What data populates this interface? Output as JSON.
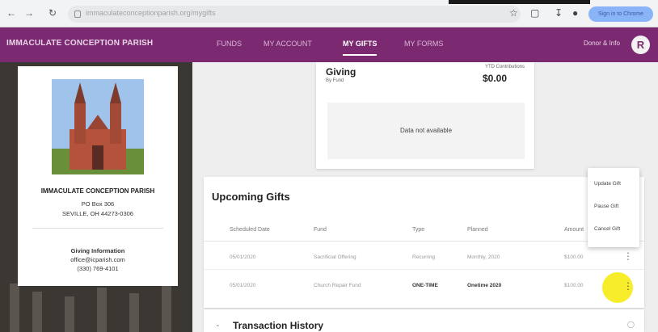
{
  "browser": {
    "url": "immaculateconceptionparish.org/mygifts",
    "profile": "Sign in to Chrome"
  },
  "header": {
    "brand": "IMMACULATE CONCEPTION PARISH",
    "tabs": [
      "FUNDS",
      "MY ACCOUNT",
      "MY GIFTS",
      "MY FORMS"
    ],
    "active_tab": "MY GIFTS",
    "user_link": "Donor & Info",
    "avatar": "R"
  },
  "parish": {
    "name": "IMMACULATE CONCEPTION PARISH",
    "address_line1": "PO Box 306",
    "address_line2": "SEVILLE, OH 44273-0306",
    "contact_heading": "Giving Information",
    "contact_email": "office@icparish.com",
    "contact_phone": "(330) 769-4101"
  },
  "giving": {
    "title": "Giving",
    "subtitle": "By Fund",
    "ytd_label": "YTD Contributions",
    "ytd_value": "$0.00",
    "no_data": "Data not available"
  },
  "upcoming": {
    "title": "Upcoming Gifts",
    "columns": [
      "Scheduled Date",
      "Fund",
      "Type",
      "Planned",
      "Amount"
    ],
    "rows": [
      [
        "05/01/2020",
        "Sacrificial Offering",
        "Recurring",
        "Monthly, 2020",
        "$100.00"
      ],
      [
        "05/01/2020",
        "Church Repair Fund",
        "ONE-TIME",
        "Onetime 2020",
        "$100.00"
      ]
    ]
  },
  "context_menu": [
    "Update Gift",
    "Pause Gift",
    "Cancel Gift"
  ],
  "history": {
    "title": "Transaction History"
  },
  "colors": {
    "brand": "#7b2a72",
    "highlight": "#f7ec20"
  }
}
